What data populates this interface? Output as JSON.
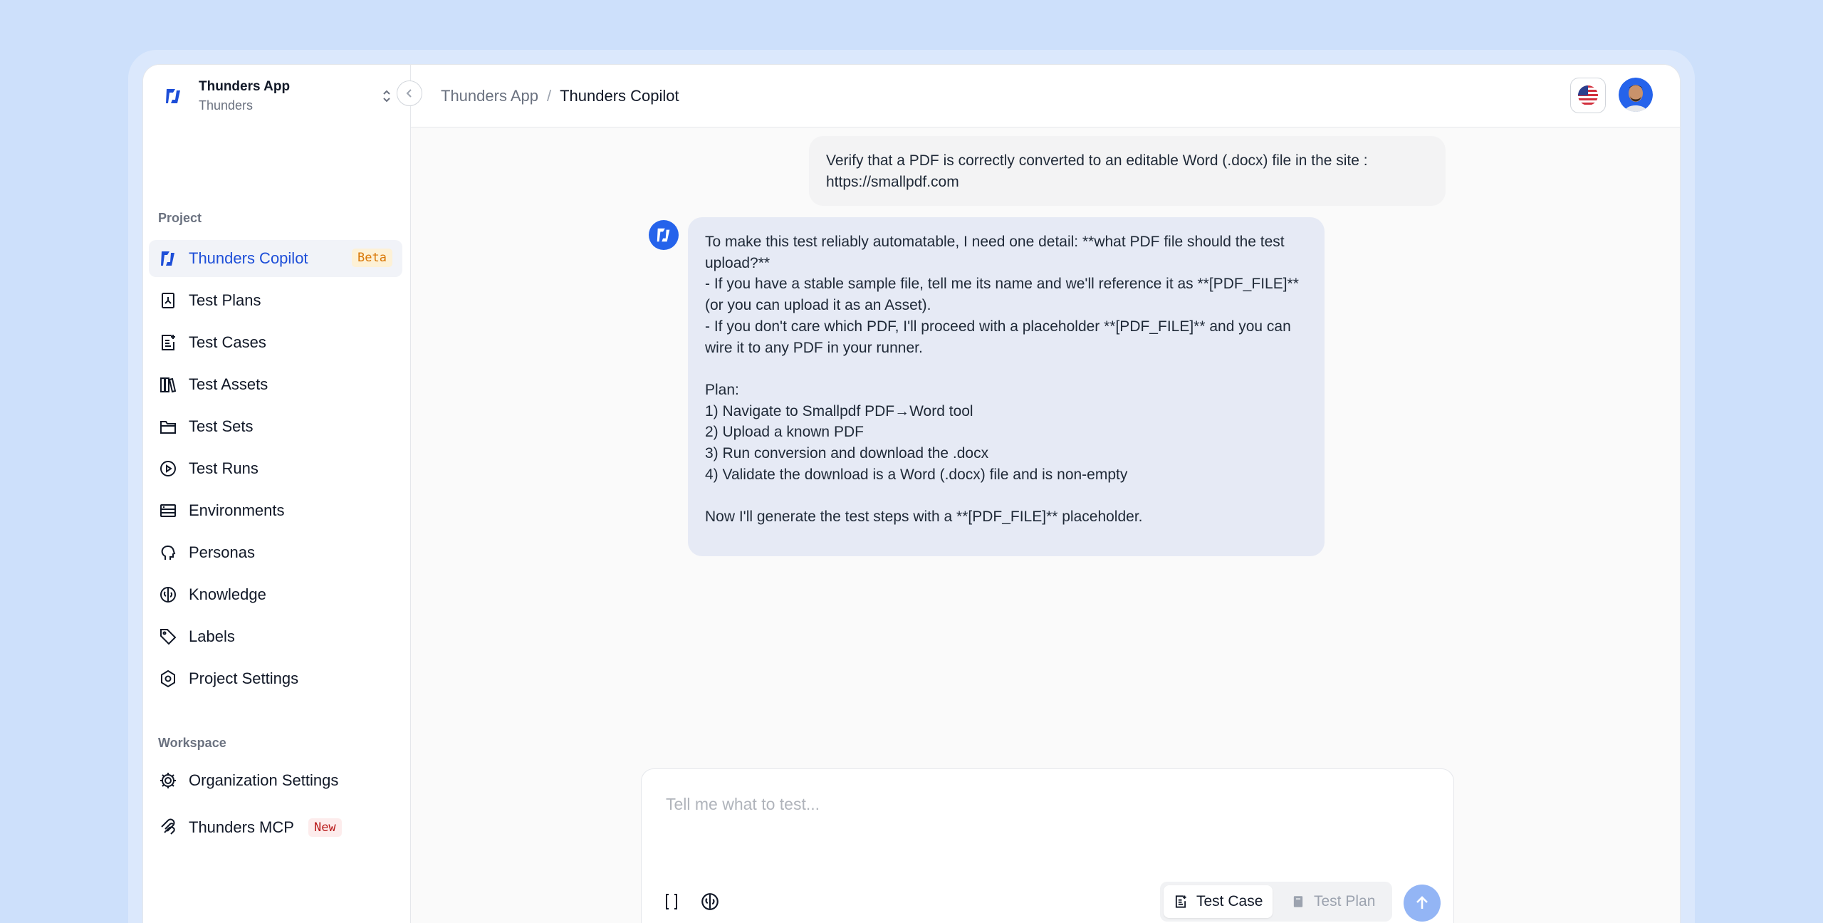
{
  "project": {
    "name": "Thunders App",
    "org": "Thunders"
  },
  "breadcrumb": {
    "root": "Thunders App",
    "separator": "/",
    "current": "Thunders Copilot"
  },
  "sidebar": {
    "project_label": "Project",
    "workspace_label": "Workspace",
    "items": [
      {
        "label": "Thunders Copilot",
        "badge": "Beta",
        "icon": "copilot-logo-icon",
        "active": true
      },
      {
        "label": "Test Plans",
        "icon": "test-plan-icon"
      },
      {
        "label": "Test Cases",
        "icon": "test-case-icon"
      },
      {
        "label": "Test Assets",
        "icon": "assets-icon"
      },
      {
        "label": "Test Sets",
        "icon": "folder-icon"
      },
      {
        "label": "Test Runs",
        "icon": "play-circle-icon"
      },
      {
        "label": "Environments",
        "icon": "server-icon"
      },
      {
        "label": "Personas",
        "icon": "head-icon"
      },
      {
        "label": "Knowledge",
        "icon": "brain-icon"
      },
      {
        "label": "Labels",
        "icon": "tag-icon"
      },
      {
        "label": "Project Settings",
        "icon": "hexagon-settings-icon"
      }
    ],
    "workspace_items": [
      {
        "label": "Organization Settings",
        "icon": "gear-icon"
      },
      {
        "label": "Thunders MCP",
        "badge": "New",
        "icon": "mcp-icon"
      }
    ]
  },
  "chat": {
    "user_message": "Verify that a PDF is correctly converted to an editable Word (.docx) file in the site : https://smallpdf.com",
    "assistant_message": "To make this test reliably automatable, I need one detail: **what PDF file should the test upload?**\n- If you have a stable sample file, tell me its name and we'll reference it as **[PDF_FILE]** (or you can upload it as an Asset).\n- If you don't care which PDF, I'll proceed with a placeholder **[PDF_FILE]** and you can wire it to any PDF in your runner.\n\nPlan:\n1) Navigate to Smallpdf PDF→Word tool\n2) Upload a known PDF\n3) Run conversion and download the .docx\n4) Validate the download is a Word (.docx) file and is non-empty\n\nNow I'll generate the test steps with a **[PDF_FILE]** placeholder."
  },
  "composer": {
    "placeholder": "Tell me what to test...",
    "variables_icon": "braces-icon",
    "knowledge_icon": "brain-icon",
    "modes": [
      {
        "label": "Test Case",
        "selected": true
      },
      {
        "label": "Test Plan",
        "selected": false
      }
    ]
  },
  "colors": {
    "accent": "#1d4ed8",
    "background": "#cde0fb",
    "send": "#93b5f5"
  }
}
